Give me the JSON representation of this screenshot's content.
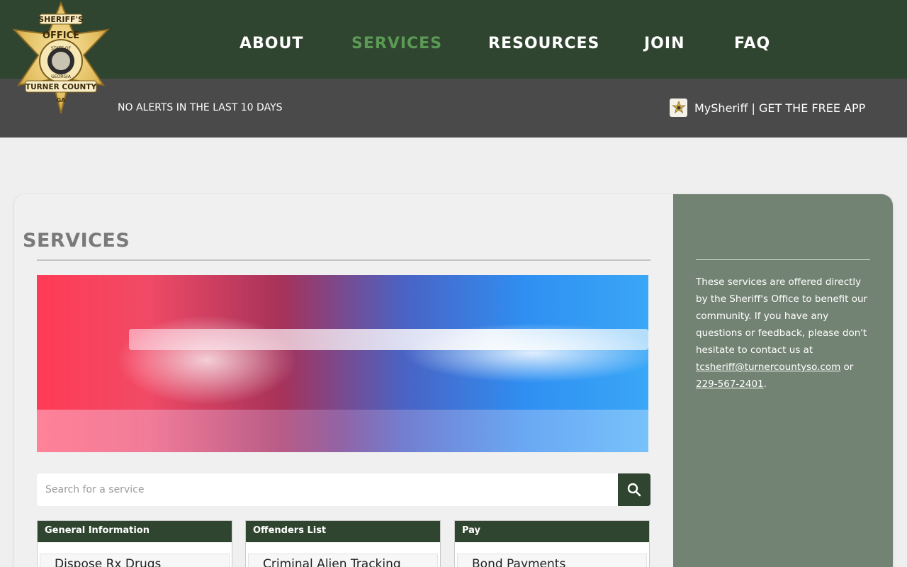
{
  "nav": {
    "items": [
      {
        "label": "ABOUT"
      },
      {
        "label": "SERVICES"
      },
      {
        "label": "RESOURCES"
      },
      {
        "label": "JOIN"
      },
      {
        "label": "FAQ"
      }
    ]
  },
  "logo": {
    "line1": "SHERIFF'S",
    "line2": "OFFICE",
    "ring_top": "STATE OF",
    "ring_bottom": "GEORGIA",
    "county": "TURNER COUNTY",
    "state_abbr": "GA"
  },
  "alerts": {
    "text": "NO ALERTS IN THE LAST 10 DAYS"
  },
  "app_promo": {
    "text": "MySheriff | GET THE FREE APP",
    "icon": "sheriff-star-icon"
  },
  "page": {
    "title": "SERVICES"
  },
  "search": {
    "placeholder": "Search for a service",
    "icon": "search-icon"
  },
  "service_groups": [
    {
      "heading": "General Information",
      "first_item": "Dispose Rx Drugs"
    },
    {
      "heading": "Offenders List",
      "first_item": "Criminal Alien Tracking"
    },
    {
      "heading": "Pay",
      "first_item": "Bond Payments"
    }
  ],
  "sidebar": {
    "intro": "These services are offered directly by the Sheriff's Office to benefit our community. If you have any questions or feedback, please don't hesitate to contact us at",
    "email": "tcsheriff@turnercountyso.com",
    "or": "or",
    "phone": "229-567-2401",
    "end": "."
  },
  "colors": {
    "header_green": "#304530",
    "active_nav": "#5b9a55",
    "alert_bar": "#4a4a4a",
    "sidebar_green": "#738373"
  }
}
